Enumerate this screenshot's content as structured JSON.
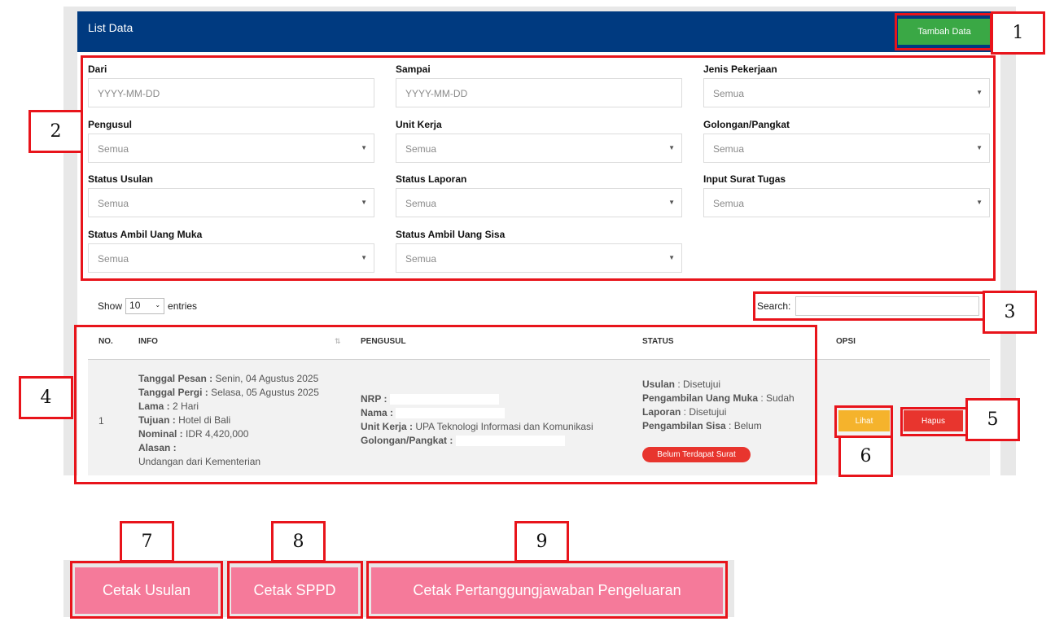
{
  "panel": {
    "title": "List Data",
    "add_button": "Tambah Data"
  },
  "filters": [
    {
      "label": "Dari",
      "placeholder": "YYYY-MM-DD",
      "type": "date"
    },
    {
      "label": "Sampai",
      "placeholder": "YYYY-MM-DD",
      "type": "date"
    },
    {
      "label": "Jenis Pekerjaan",
      "value": "Semua",
      "type": "select"
    },
    {
      "label": "Pengusul",
      "value": "Semua",
      "type": "select"
    },
    {
      "label": "Unit Kerja",
      "value": "Semua",
      "type": "select"
    },
    {
      "label": "Golongan/Pangkat",
      "value": "Semua",
      "type": "select"
    },
    {
      "label": "Status Usulan",
      "value": "Semua",
      "type": "select"
    },
    {
      "label": "Status Laporan",
      "value": "Semua",
      "type": "select"
    },
    {
      "label": "Input Surat Tugas",
      "value": "Semua",
      "type": "select"
    },
    {
      "label": "Status Ambil Uang Muka",
      "value": "Semua",
      "type": "select"
    },
    {
      "label": "Status Ambil Uang Sisa",
      "value": "Semua",
      "type": "select"
    }
  ],
  "table_controls": {
    "show_label": "Show",
    "entries_value": "10",
    "entries_label": "entries",
    "search_label": "Search:"
  },
  "table": {
    "headers": {
      "no": "NO.",
      "info": "INFO",
      "pengusul": "PENGUSUL",
      "status": "STATUS",
      "opsi": "OPSI"
    },
    "row": {
      "no": "1",
      "info": {
        "tanggal_pesan_label": "Tanggal Pesan :",
        "tanggal_pesan": " Senin, 04 Agustus 2025",
        "tanggal_pergi_label": "Tanggal Pergi :",
        "tanggal_pergi": " Selasa, 05 Agustus 2025",
        "lama_label": "Lama :",
        "lama": " 2 Hari",
        "tujuan_label": "Tujuan :",
        "tujuan": " Hotel di Bali",
        "nominal_label": "Nominal :",
        "nominal": " IDR 4,420,000",
        "alasan_label": "Alasan :",
        "alasan": "Undangan dari Kementerian"
      },
      "pengusul": {
        "nrp_label": "NRP :",
        "nama_label": "Nama :",
        "unit_kerja_label": "Unit Kerja :",
        "unit_kerja": " UPA Teknologi Informasi dan Komunikasi",
        "golongan_label": "Golongan/Pangkat :"
      },
      "status": {
        "usulan_label": "Usulan",
        "usulan": " : Disetujui",
        "uang_muka_label": "Pengambilan Uang Muka",
        "uang_muka": " : Sudah",
        "laporan_label": "Laporan",
        "laporan": " : Disetujui",
        "sisa_label": "Pengambilan Sisa",
        "sisa": " : Belum",
        "badge": "Belum Terdapat Surat"
      },
      "opsi": {
        "lihat": "Lihat",
        "hapus": "Hapus"
      }
    }
  },
  "bottom_buttons": {
    "cetak_usulan": "Cetak Usulan",
    "cetak_sppd": "Cetak SPPD",
    "cetak_pertanggungjawaban": "Cetak Pertanggungjawaban Pengeluaran"
  },
  "annotations": [
    "1",
    "2",
    "3",
    "4",
    "5",
    "6",
    "7",
    "8",
    "9"
  ],
  "colors": {
    "header_blue": "#003a80",
    "add_green": "#3aa845",
    "lihat_yellow": "#f5b32c",
    "hapus_red": "#e8352e",
    "print_pink": "#f57a9a",
    "annotation_red": "#e8141b"
  }
}
